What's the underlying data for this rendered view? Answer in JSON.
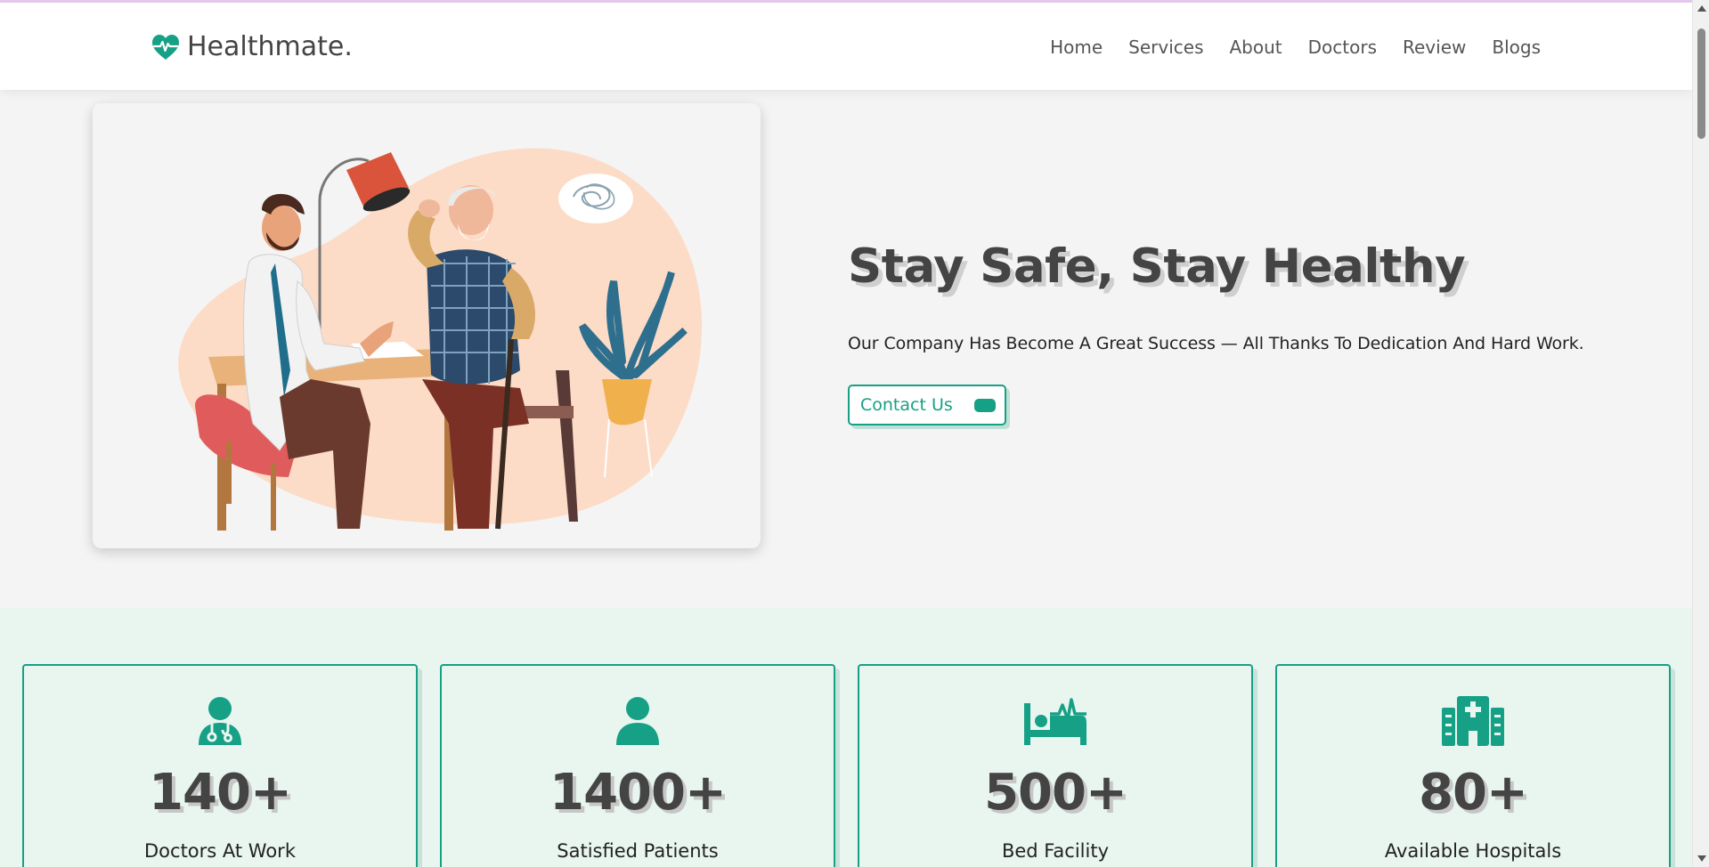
{
  "brand": {
    "name": "Healthmate.",
    "icon": "heartbeat-icon"
  },
  "nav": {
    "items": [
      "Home",
      "Services",
      "About",
      "Doctors",
      "Review",
      "Blogs"
    ]
  },
  "hero": {
    "title": "Stay Safe, Stay Healthy",
    "subtitle": "Our Company Has Become A Great Success — All Thanks To Dedication And Hard Work.",
    "cta_label": "Contact Us"
  },
  "stats": [
    {
      "icon": "doctor-icon",
      "value": "140+",
      "label": "Doctors At Work"
    },
    {
      "icon": "user-icon",
      "value": "1400+",
      "label": "Satisfied Patients"
    },
    {
      "icon": "bed-pulse-icon",
      "value": "500+",
      "label": "Bed Facility"
    },
    {
      "icon": "hospital-icon",
      "value": "80+",
      "label": "Available Hospitals"
    }
  ],
  "colors": {
    "accent": "#16a085",
    "heading": "#444444",
    "stats_background": "#e8f6ef",
    "page_background": "#f4f4f4"
  }
}
